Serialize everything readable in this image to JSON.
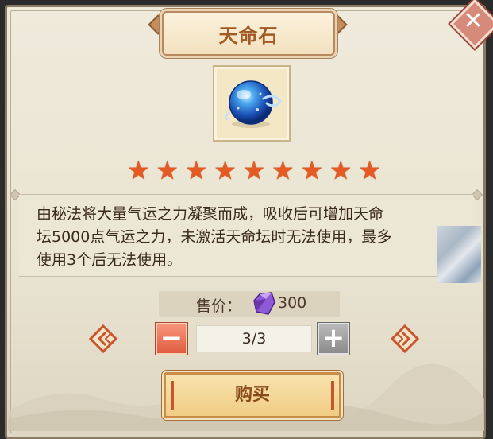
{
  "dialog": {
    "title": "天命石"
  },
  "item": {
    "icon": "blue-orb-icon",
    "stars": 9
  },
  "description": {
    "lines": [
      "由秘法将大量气运之力凝聚而成，吸收后可增加天命",
      "坛5000点气运之力，未激活天命坛时无法使用，最多",
      "使用3个后无法使用。"
    ]
  },
  "price": {
    "label": "售价：",
    "currency_icon": "purple-gem-icon",
    "value": "300"
  },
  "quantity": {
    "display": "3/3"
  },
  "buy": {
    "label": "购买"
  },
  "colors": {
    "accent": "#e45a22",
    "title_text": "#a05a23",
    "minus_button": "#e05c3f",
    "plus_button_disabled": "#8b8b8b",
    "buy_button": "#f0cd85"
  }
}
